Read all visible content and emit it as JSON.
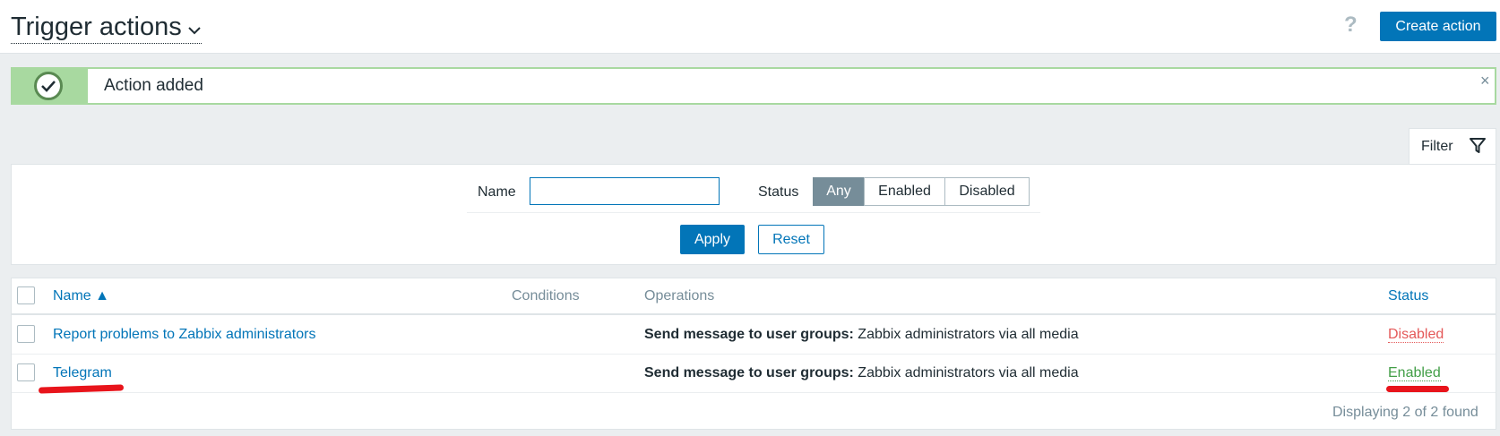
{
  "header": {
    "title": "Trigger actions",
    "help_icon": "?",
    "create_button": "Create action"
  },
  "message": {
    "text": "Action added",
    "close": "×",
    "icon": "check-circle-icon",
    "color": "#a8d9a0"
  },
  "filter": {
    "tab_label": "Filter",
    "name_label": "Name",
    "name_value": "",
    "status_label": "Status",
    "status_options": [
      "Any",
      "Enabled",
      "Disabled"
    ],
    "status_selected": "Any",
    "apply": "Apply",
    "reset": "Reset"
  },
  "table": {
    "columns": {
      "name": "Name ▲",
      "conditions": "Conditions",
      "operations": "Operations",
      "status": "Status"
    },
    "rows": [
      {
        "name": "Report problems to Zabbix administrators",
        "operations_bold": "Send message to user groups:",
        "operations_text": " Zabbix administrators via all media",
        "status": "Disabled"
      },
      {
        "name": "Telegram",
        "operations_bold": "Send message to user groups:",
        "operations_text": " Zabbix administrators via all media",
        "status": "Enabled"
      }
    ],
    "footer": "Displaying 2 of 2 found"
  },
  "colors": {
    "primary": "#0275b8",
    "enabled": "#429e47",
    "disabled": "#e45959",
    "annotation": "#e8141b"
  }
}
